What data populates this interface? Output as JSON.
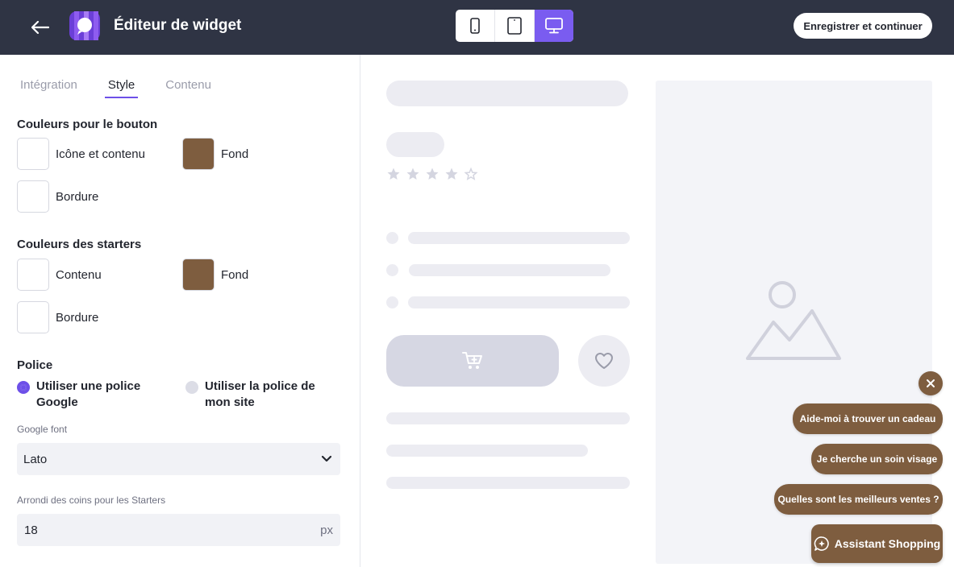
{
  "header": {
    "title": "Éditeur de widget",
    "save_label": "Enregistrer et continuer",
    "devices": [
      "mobile-icon",
      "tablet-icon",
      "desktop-icon"
    ],
    "active_device": "desktop"
  },
  "tabs": [
    {
      "label": "Intégration",
      "active": false
    },
    {
      "label": "Style",
      "active": true
    },
    {
      "label": "Contenu",
      "active": false
    }
  ],
  "button_colors": {
    "title": "Couleurs pour le bouton",
    "icon_content_label": "Icône et contenu",
    "icon_content_color": "#ffffff",
    "background_label": "Fond",
    "background_color": "#7e5d3f",
    "border_label": "Bordure",
    "border_color": "#ffffff"
  },
  "starter_colors": {
    "title": "Couleurs des starters",
    "content_label": "Contenu",
    "content_color": "#ffffff",
    "background_label": "Fond",
    "background_color": "#7e5d3f",
    "border_label": "Bordure",
    "border_color": "#ffffff"
  },
  "font": {
    "title": "Police",
    "option_google": "Utiliser une police Google",
    "option_site": "Utiliser la police de mon site",
    "selected": "google",
    "google_font_label": "Google font",
    "google_font_value": "Lato"
  },
  "corner_radius": {
    "label": "Arrondi des coins pour les Starters",
    "value": "18",
    "unit": "px"
  },
  "preview": {
    "rating_stars_filled": 4,
    "rating_stars_total": 5,
    "starters": [
      "Aide-moi à trouver un cadeau",
      "Je cherche un soin visage",
      "Quelles sont les meilleurs ventes ?"
    ],
    "assistant_label": "Assistant Shopping",
    "accent_color": "#7a5cf0",
    "brand_brown": "#7e5d3f"
  }
}
